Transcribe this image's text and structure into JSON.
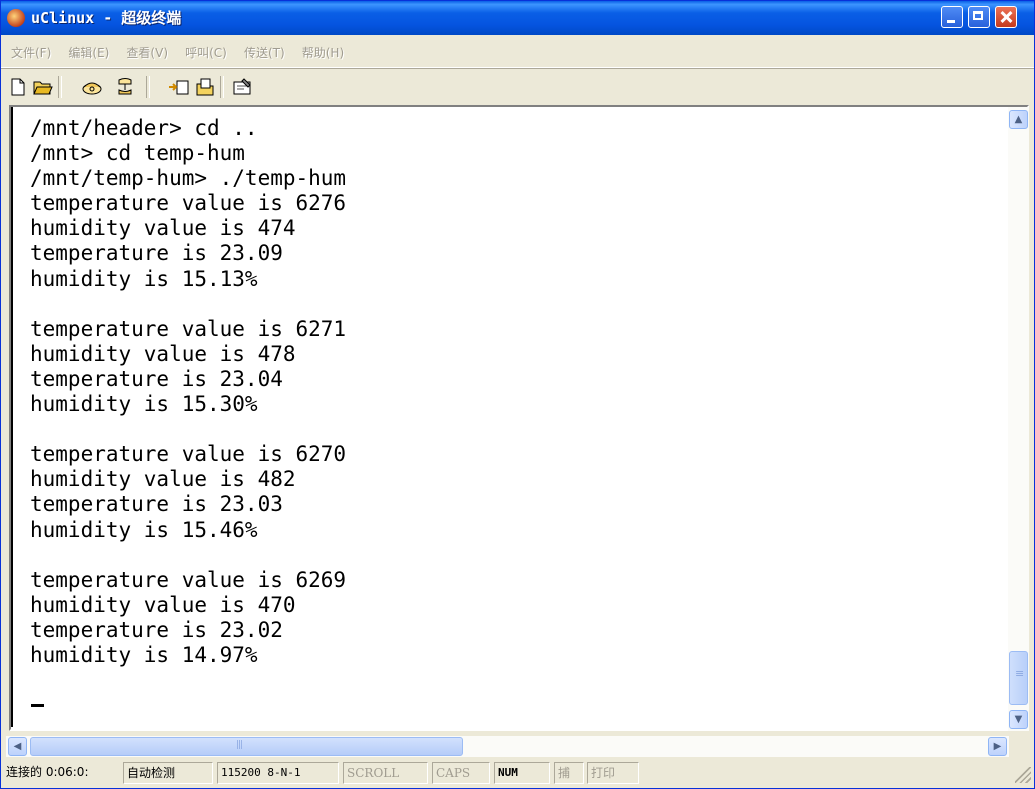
{
  "window": {
    "title": "uClinux - 超级终端"
  },
  "menu": {
    "items": [
      "文件(F)",
      "编辑(E)",
      "查看(V)",
      "呼叫(C)",
      "传送(T)",
      "帮助(H)"
    ]
  },
  "toolbar": {
    "icons": [
      "new-icon",
      "open-icon",
      "call-icon",
      "disconnect-icon",
      "send-icon",
      "receive-icon",
      "properties-icon"
    ]
  },
  "terminal": {
    "lines": [
      "/mnt/header> cd ..",
      "/mnt> cd temp-hum",
      "/mnt/temp-hum> ./temp-hum",
      "temperature value is 6276",
      "humidity value is 474",
      "temperature is 23.09",
      "humidity is 15.13%",
      "",
      "temperature value is 6271",
      "humidity value is 478",
      "temperature is 23.04",
      "humidity is 15.30%",
      "",
      "temperature value is 6270",
      "humidity value is 482",
      "temperature is 23.03",
      "humidity is 15.46%",
      "",
      "temperature value is 6269",
      "humidity value is 470",
      "temperature is 23.02",
      "humidity is 14.97%"
    ]
  },
  "statusbar": {
    "connected": "连接的 0:06:0:",
    "detect": "自动检测",
    "port": "115200 8-N-1",
    "scroll": "SCROLL",
    "caps": "CAPS",
    "num": "NUM",
    "capture": "捕",
    "print": "打印"
  }
}
